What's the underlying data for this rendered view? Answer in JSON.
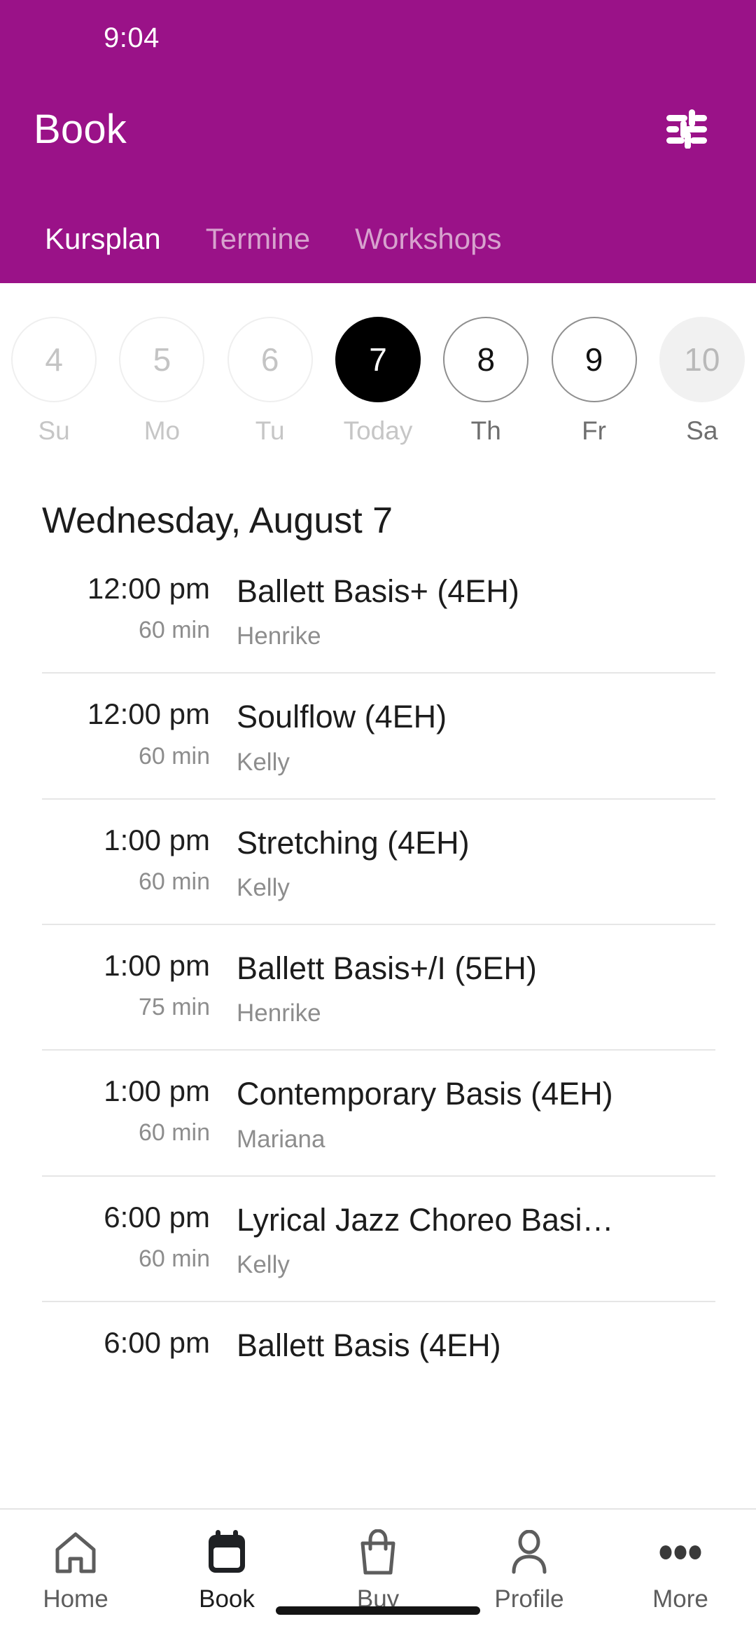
{
  "theme": {
    "brand_purple": "#9A1288",
    "accent_black": "#000000",
    "muted_grey": "#8d8d8d"
  },
  "status_bar": {
    "time": "9:04"
  },
  "header": {
    "title": "Book",
    "filter_icon": "sliders-icon"
  },
  "tabs": [
    {
      "label": "Kursplan",
      "active": true
    },
    {
      "label": "Termine",
      "active": false
    },
    {
      "label": "Workshops",
      "active": false
    }
  ],
  "date_strip": [
    {
      "day": "4",
      "weekday": "Su",
      "state": "disabled"
    },
    {
      "day": "5",
      "weekday": "Mo",
      "state": "disabled"
    },
    {
      "day": "6",
      "weekday": "Tu",
      "state": "disabled"
    },
    {
      "day": "7",
      "weekday": "Today",
      "state": "selected"
    },
    {
      "day": "8",
      "weekday": "Th",
      "state": "normal"
    },
    {
      "day": "9",
      "weekday": "Fr",
      "state": "normal"
    },
    {
      "day": "10",
      "weekday": "Sa",
      "state": "filled"
    }
  ],
  "schedule": {
    "date_heading": "Wednesday, August 7",
    "classes": [
      {
        "time": "12:00 pm",
        "duration": "60 min",
        "name": "Ballett Basis+ (4EH)",
        "instructor": "Henrike"
      },
      {
        "time": "12:00 pm",
        "duration": "60 min",
        "name": "Soulflow (4EH)",
        "instructor": "Kelly"
      },
      {
        "time": "1:00 pm",
        "duration": "60 min",
        "name": "Stretching (4EH)",
        "instructor": "Kelly"
      },
      {
        "time": "1:00 pm",
        "duration": "75 min",
        "name": "Ballett Basis+/I (5EH)",
        "instructor": "Henrike"
      },
      {
        "time": "1:00 pm",
        "duration": "60 min",
        "name": "Contemporary Basis (4EH)",
        "instructor": "Mariana"
      },
      {
        "time": "6:00 pm",
        "duration": "60 min",
        "name": "Lyrical Jazz Choreo Basi…",
        "instructor": "Kelly"
      },
      {
        "time": "6:00 pm",
        "duration": "",
        "name": "Ballett Basis (4EH)",
        "instructor": ""
      }
    ]
  },
  "bottom_nav": [
    {
      "label": "Home",
      "icon": "house-icon",
      "active": false
    },
    {
      "label": "Book",
      "icon": "calendar-icon",
      "active": true
    },
    {
      "label": "Buy",
      "icon": "shopping-bag-icon",
      "active": false
    },
    {
      "label": "Profile",
      "icon": "person-icon",
      "active": false
    },
    {
      "label": "More",
      "icon": "three-dots-icon",
      "active": false
    }
  ]
}
